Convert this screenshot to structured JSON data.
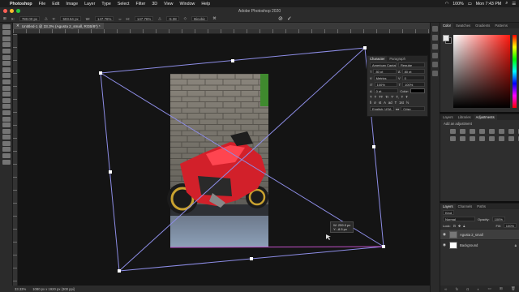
{
  "menubar": {
    "app_name": "Photoshop",
    "items": [
      "File",
      "Edit",
      "Image",
      "Layer",
      "Type",
      "Select",
      "Filter",
      "3D",
      "View",
      "Window",
      "Help"
    ],
    "battery": "100%",
    "clock": "Mon 7:43 PM"
  },
  "window": {
    "title": "Adobe Photoshop 2020"
  },
  "options": {
    "x_label": "X:",
    "x_value": "780.00 px",
    "y_label": "Y:",
    "y_value": "503.54 px",
    "w_label": "W:",
    "w_value": "147.76%",
    "h_label": "H:",
    "h_value": "147.76%",
    "angle_value": "-5.38",
    "interpolation": "Bicubic"
  },
  "document": {
    "tab_label": "Untitled-1 @ 33.3% (Agusta 2_small, RGB/8*) *"
  },
  "transform_readout": {
    "line1": "W: 259.0 px",
    "line2": "Y:  -8.5 px"
  },
  "status": {
    "zoom": "33.33%",
    "doc_info": "1080 px x 1920 px (300 ppi)"
  },
  "color_panel": {
    "tabs": [
      "Color",
      "Swatches",
      "Gradients",
      "Patterns"
    ],
    "active_tab": "Color",
    "foreground": "#e8e8e8",
    "background": "#111111"
  },
  "character_panel": {
    "tabs": [
      "Character",
      "Paragraph"
    ],
    "font_family": "American Captain",
    "font_style": "Regular",
    "font_size": "80 pt",
    "leading": "80 pt",
    "kerning": "Metrics",
    "tracking": "0",
    "vscale": "100%",
    "hscale": "100%",
    "baseline": "0 pt",
    "color_label": "Color:",
    "glyphs": [
      "T",
      "T",
      "TT",
      "Tr",
      "T'",
      "T,",
      "T",
      "Ŧ"
    ],
    "glyphs2": [
      "fi",
      "ơ",
      "st",
      "A",
      "ad",
      "T",
      "1st",
      "½"
    ],
    "language": "English: USA",
    "antialias_label": "aa",
    "antialias": "Crisp"
  },
  "adjustments_panel": {
    "tabs": [
      "Layers",
      "Libraries",
      "Adjustments"
    ],
    "active_tab": "Adjustments",
    "hint": "Add an adjustment"
  },
  "layers_panel": {
    "tabs": [
      "Layers",
      "Channels",
      "Paths"
    ],
    "filter_label": "Kind",
    "blend_mode": "Normal",
    "opacity_label": "Opacity:",
    "opacity": "100%",
    "lock_label": "Lock:",
    "fill_label": "Fill:",
    "fill": "100%",
    "layers": [
      {
        "name": "Agusta 2_small",
        "selected": true
      },
      {
        "name": "Background",
        "selected": false
      }
    ]
  },
  "colors": {
    "bounding_box": "#8d8de6",
    "canvas_edge": "#c050c8",
    "accent": "#ff5f57"
  }
}
